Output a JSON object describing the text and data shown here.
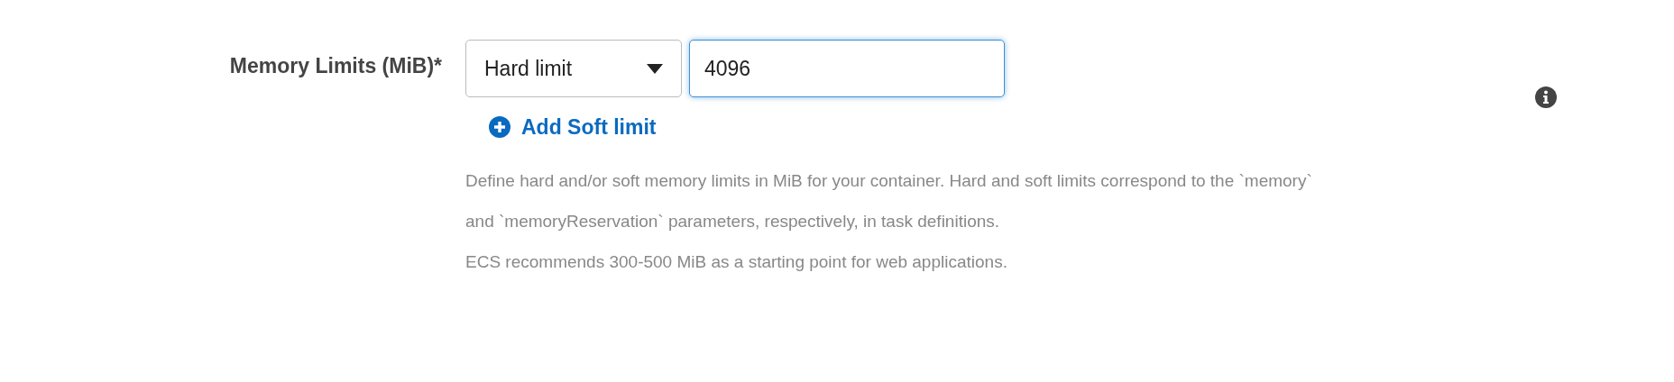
{
  "field": {
    "label": "Memory Limits (MiB)*",
    "select": {
      "value": "Hard limit"
    },
    "input": {
      "value": "4096",
      "focused": true
    },
    "add_link": "Add Soft limit",
    "help": [
      "Define hard and/or soft memory limits in MiB for your container. Hard and soft limits correspond to the `memory` and `memoryReservation` parameters, respectively, in task definitions.",
      "ECS recommends 300-500 MiB as a starting point for web applications."
    ]
  }
}
